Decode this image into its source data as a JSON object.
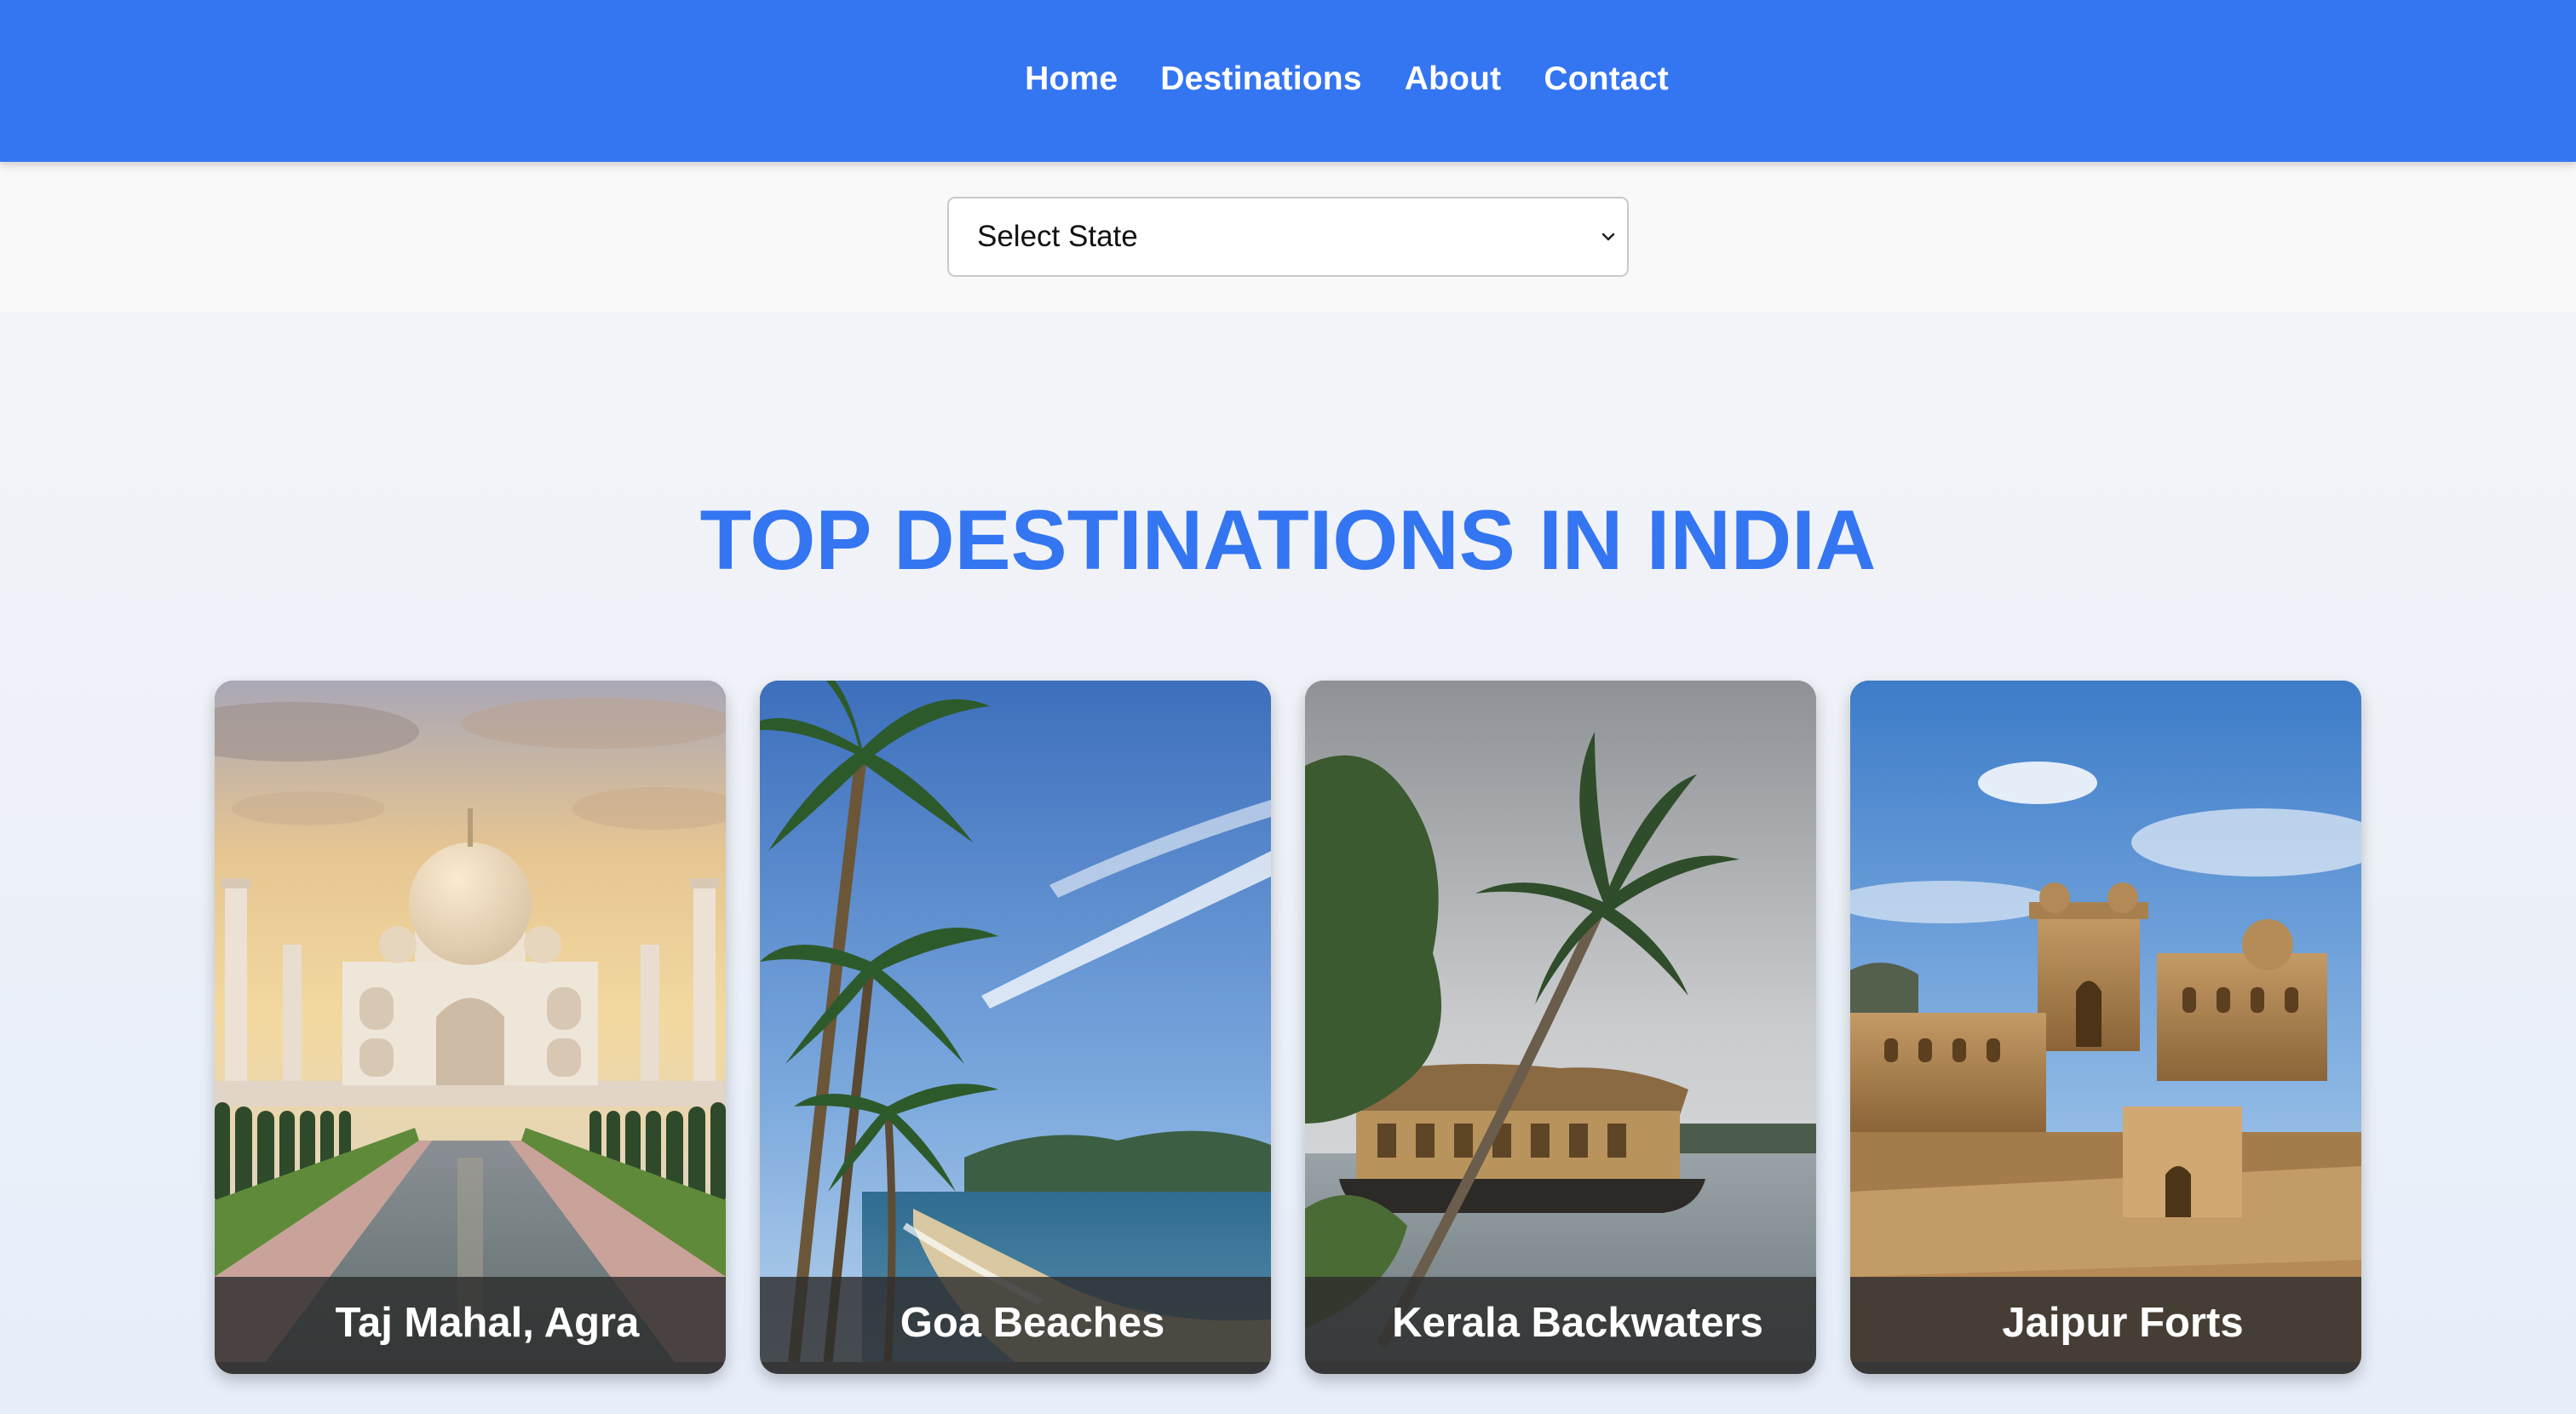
{
  "nav": {
    "items": [
      {
        "label": "Home"
      },
      {
        "label": "Destinations"
      },
      {
        "label": "About"
      },
      {
        "label": "Contact"
      }
    ]
  },
  "filter": {
    "selected": "Select State"
  },
  "section": {
    "title": "TOP DESTINATIONS IN INDIA"
  },
  "destinations": [
    {
      "name": "Taj Mahal, Agra",
      "image": "taj-mahal-photo"
    },
    {
      "name": "Goa Beaches",
      "image": "goa-beach-photo"
    },
    {
      "name": "Kerala Backwaters",
      "image": "kerala-houseboat-photo"
    },
    {
      "name": "Jaipur Forts",
      "image": "jaipur-fort-photo"
    }
  ],
  "colors": {
    "brand_blue": "#3475f2",
    "caption_bg": "#2d2d2d",
    "text_white": "#ffffff"
  }
}
